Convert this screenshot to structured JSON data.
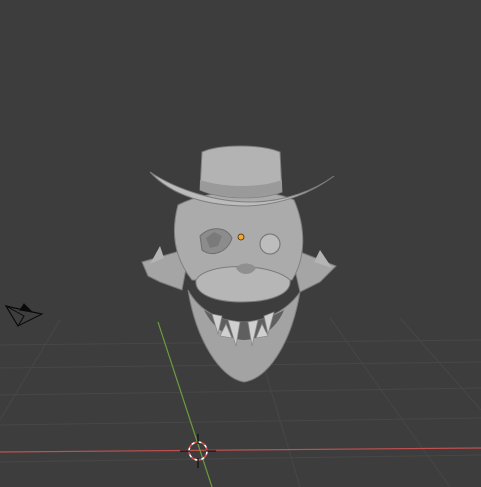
{
  "viewport": {
    "background": "#3d3d3d",
    "grid_color": "#474747",
    "x_axis_color": "#c25050",
    "y_axis_color": "#6f9c3c"
  },
  "model": {
    "icon": "character-head-mesh",
    "surface_color": "#a9a9a9",
    "shadow_color": "#7e7e7e",
    "highlight_color": "#c8c8c8"
  },
  "origin_point": {
    "icon": "object-origin-dot",
    "color": "#f7a52b"
  },
  "camera": {
    "icon": "camera-icon"
  },
  "cursor_3d": {
    "icon": "3d-cursor-icon",
    "color_a": "#ffffff",
    "color_b": "#e14b4b"
  }
}
